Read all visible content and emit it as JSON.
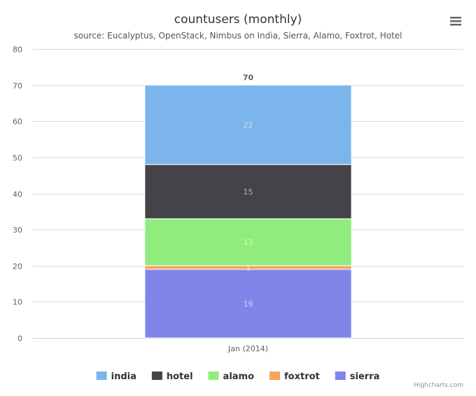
{
  "menu": {
    "icon": "hamburger-menu-icon"
  },
  "credits": "Highcharts.com",
  "chart_data": {
    "type": "bar",
    "stacked": true,
    "orientation": "vertical",
    "title": "countusers (monthly)",
    "subtitle": "source: Eucalyptus, OpenStack, Nimbus on India, Sierra, Alamo, Foxtrot, Hotel",
    "categories": [
      "Jan (2014)"
    ],
    "xlabel": "",
    "ylabel": "",
    "ylim": [
      0,
      80
    ],
    "yticks": [
      0,
      10,
      20,
      30,
      40,
      50,
      60,
      70,
      80
    ],
    "grid": true,
    "legend_position": "bottom-center",
    "stack_totals": [
      70
    ],
    "series": [
      {
        "name": "india",
        "values": [
          22
        ],
        "color": "#7cb5ec"
      },
      {
        "name": "hotel",
        "values": [
          15
        ],
        "color": "#434348"
      },
      {
        "name": "alamo",
        "values": [
          13
        ],
        "color": "#90ed7d"
      },
      {
        "name": "foxtrot",
        "values": [
          1
        ],
        "color": "#f7a35c"
      },
      {
        "name": "sierra",
        "values": [
          19
        ],
        "color": "#8085e9"
      }
    ]
  }
}
